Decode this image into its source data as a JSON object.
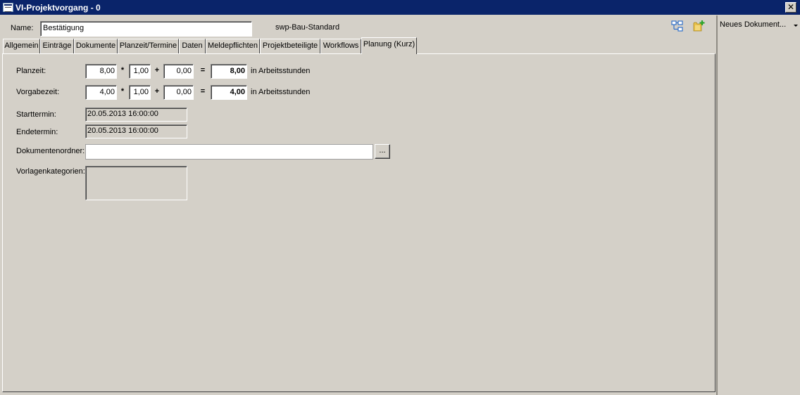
{
  "window": {
    "title": "VI-Projektvorgang - 0",
    "close_glyph": "✕"
  },
  "header": {
    "name_label": "Name:",
    "name_value": "Bestätigung",
    "template_name": "swp-Bau-Standard"
  },
  "tabs": [
    {
      "label": "Allgemein"
    },
    {
      "label": "Einträge"
    },
    {
      "label": "Dokumente"
    },
    {
      "label": "Planzeit/Termine"
    },
    {
      "label": "Daten"
    },
    {
      "label": "Meldepflichten"
    },
    {
      "label": "Projektbeteiligte"
    },
    {
      "label": "Workflows"
    },
    {
      "label": "Planung (Kurz)"
    }
  ],
  "active_tab": "Planung (Kurz)",
  "planning": {
    "planzeit": {
      "label": "Planzeit:",
      "value": "8,00",
      "factor": "1,00",
      "addend": "0,00",
      "result": "8,00",
      "unit": "in Arbeitsstunden"
    },
    "vorgabezeit": {
      "label": "Vorgabezeit:",
      "value": "4,00",
      "factor": "1,00",
      "addend": "0,00",
      "result": "4,00",
      "unit": "in Arbeitsstunden"
    },
    "op_multiply": "*",
    "op_plus": "+",
    "op_equals": "=",
    "starttermin": {
      "label": "Starttermin:",
      "value": "20.05.2013 16:00:00"
    },
    "endetermin": {
      "label": "Endetermin:",
      "value": "20.05.2013 16:00:00"
    },
    "dokumentenordner": {
      "label": "Dokumentenordner:",
      "value": "",
      "browse_label": "..."
    },
    "vorlagenkategorien": {
      "label": "Vorlagenkategorien:"
    }
  },
  "side_panel": {
    "new_document_label": "Neues Dokument..."
  },
  "icons": {
    "title": "form-window-icon",
    "tree": "process-tree-icon",
    "folder": "folder-add-icon",
    "close": "close-icon",
    "dropdown": "chevron-down-icon"
  },
  "colors": {
    "titlebar": "#0a246a",
    "face": "#d4d0c8",
    "tree_icon": "#2f6fc9",
    "folder_icon": "#e8c14a",
    "plus_icon": "#2aa52a"
  }
}
